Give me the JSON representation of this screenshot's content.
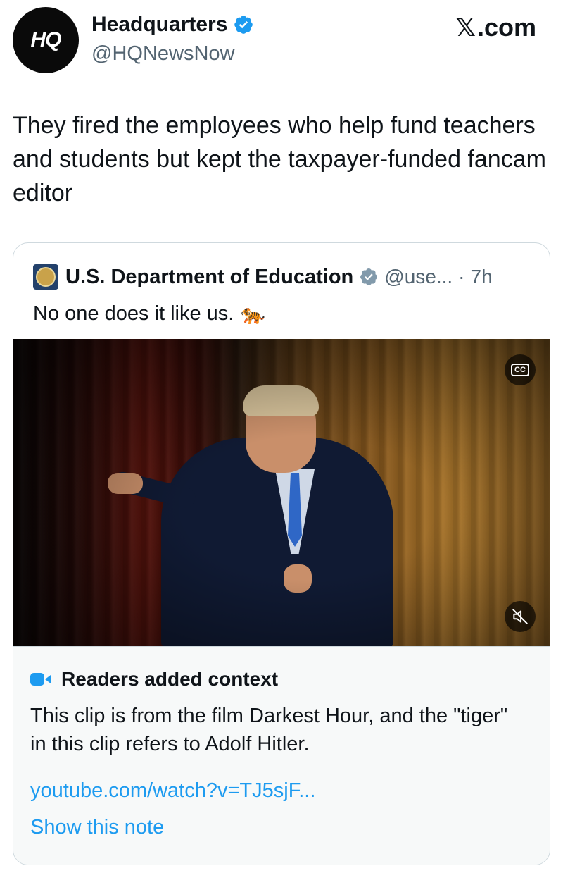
{
  "header": {
    "avatar_text": "HQ",
    "display_name": "Headquarters",
    "handle": "@HQNewsNow",
    "site_x": "𝕏",
    "site_suffix": ".com"
  },
  "post": {
    "text": "They fired the employees who help fund teachers and students but kept the taxpayer-funded fancam editor"
  },
  "quote": {
    "name": "U.S. Department of Education",
    "handle": "@use...",
    "separator": "·",
    "time": "7h",
    "text": "No one does it like us.",
    "emoji": "🐅",
    "video": {
      "cc_label": "CC",
      "mute_icon": "muted-speaker-icon"
    }
  },
  "context": {
    "title": "Readers added context",
    "body": "This clip is from the film Darkest Hour, and the \"tiger\" in this clip refers to Adolf Hitler.",
    "link": "youtube.com/watch?v=TJ5sjF...",
    "show_note": "Show this note"
  },
  "colors": {
    "accent": "#1d9bf0",
    "text": "#0f1419",
    "muted": "#536471"
  }
}
